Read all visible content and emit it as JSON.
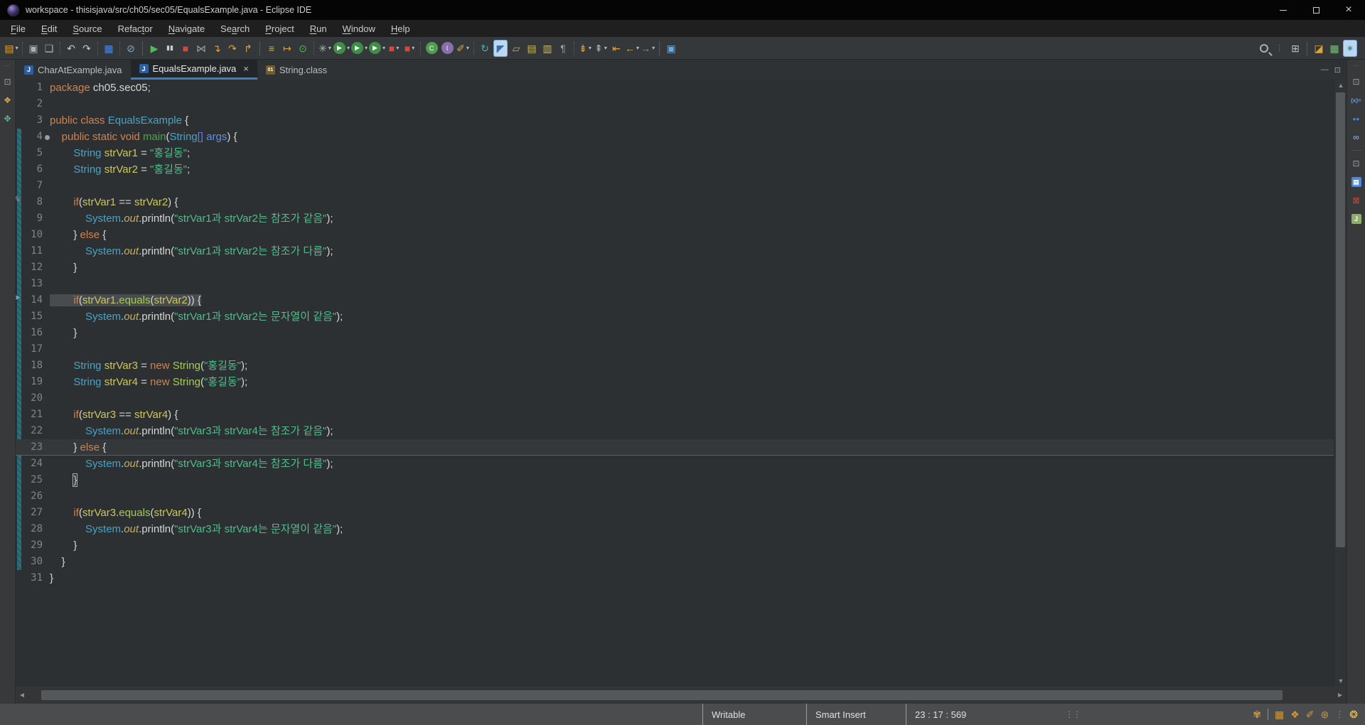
{
  "window": {
    "title": "workspace - thisisjava/src/ch05/sec05/EqualsExample.java - Eclipse IDE",
    "controls": {
      "minimize": "minimize",
      "maximize": "maximize",
      "close": "×"
    }
  },
  "menu": {
    "items": [
      {
        "label": "File",
        "mn": 0
      },
      {
        "label": "Edit",
        "mn": 0
      },
      {
        "label": "Source",
        "mn": 0
      },
      {
        "label": "Refactor",
        "mn": 5
      },
      {
        "label": "Navigate",
        "mn": 0
      },
      {
        "label": "Search",
        "mn": 2
      },
      {
        "label": "Project",
        "mn": 0
      },
      {
        "label": "Run",
        "mn": 0
      },
      {
        "label": "Window",
        "mn": 0
      },
      {
        "label": "Help",
        "mn": 0
      }
    ]
  },
  "toolbar": {
    "items": [
      {
        "n": "new-wizard",
        "g": "▤",
        "c": "#d8a947",
        "dd": true
      },
      {
        "t": "sep"
      },
      {
        "n": "save",
        "g": "▣",
        "c": "#a9afb3"
      },
      {
        "n": "save-all",
        "g": "❏",
        "c": "#a9afb3"
      },
      {
        "t": "sep"
      },
      {
        "n": "undo",
        "g": "↶",
        "c": "#c7cbce"
      },
      {
        "n": "redo",
        "g": "↷",
        "c": "#c7cbce"
      },
      {
        "t": "sep"
      },
      {
        "n": "open-console",
        "g": "▦",
        "c": "#4e86d8"
      },
      {
        "t": "sep"
      },
      {
        "n": "skip-all-breakpoints",
        "g": "⊘",
        "c": "#8fa6c2"
      },
      {
        "t": "bar"
      },
      {
        "n": "resume",
        "g": "▶",
        "c": "#55b85c"
      },
      {
        "n": "pause",
        "g": "▮▮",
        "c": "#c8cdcf"
      },
      {
        "n": "terminate",
        "g": "■",
        "c": "#d8453c"
      },
      {
        "n": "disconnect",
        "g": "⋈",
        "c": "#9a9fa3"
      },
      {
        "n": "step-into",
        "g": "↴",
        "c": "#dca43e"
      },
      {
        "n": "step-over",
        "g": "↷",
        "c": "#dca43e"
      },
      {
        "n": "step-return",
        "g": "↱",
        "c": "#dca43e"
      },
      {
        "t": "bar"
      },
      {
        "n": "use-step-filters",
        "g": "≡",
        "c": "#c0b26a"
      },
      {
        "n": "run-to-line",
        "g": "↦",
        "c": "#dca43e"
      },
      {
        "n": "terminate-all",
        "g": "⊙",
        "c": "#55b85c"
      },
      {
        "t": "sep"
      },
      {
        "n": "new-launch-config",
        "g": "✳",
        "c": "#9fbfa8",
        "dd": true
      },
      {
        "n": "debug",
        "g": "▶",
        "bg": "#3e8f46",
        "dd": true
      },
      {
        "n": "run",
        "g": "▶",
        "bg": "#3e8f46",
        "dd": true
      },
      {
        "n": "coverage",
        "g": "▶",
        "bg": "#3e8f46",
        "dd": true
      },
      {
        "n": "profile",
        "g": "■",
        "c": "#d8453c",
        "dd": true
      },
      {
        "n": "stop",
        "g": "■",
        "c": "#d8453c",
        "dd": true
      },
      {
        "t": "sep"
      },
      {
        "n": "new-java-class",
        "g": "C",
        "bg": "#4e9e4e"
      },
      {
        "n": "new-java-interface",
        "g": "I",
        "bg": "#8a6fae"
      },
      {
        "n": "external-tools",
        "g": "✐",
        "c": "#dca43e",
        "dd": true
      },
      {
        "t": "sep"
      },
      {
        "n": "refresh",
        "g": "↻",
        "c": "#4fb0a5"
      },
      {
        "n": "devstyle",
        "g": "◤",
        "c": "#3a6ea5",
        "act": true
      },
      {
        "n": "open-resource",
        "g": "▱",
        "c": "#c9a14e"
      },
      {
        "n": "show-source",
        "g": "▤",
        "c": "#c9b96a"
      },
      {
        "n": "templates",
        "g": "▥",
        "c": "#c9b96a"
      },
      {
        "n": "show-whitespace",
        "g": "¶",
        "c": "#9aa0a4"
      },
      {
        "t": "sep"
      },
      {
        "n": "next-annotation",
        "g": "⇟",
        "c": "#dca43e",
        "dd": true
      },
      {
        "n": "previous-annotation",
        "g": "⇞",
        "c": "#aeb4b8",
        "dd": true
      },
      {
        "n": "last-edit-location",
        "g": "⇤",
        "c": "#dca43e"
      },
      {
        "n": "back",
        "g": "←",
        "c": "#dca43e",
        "dd": true
      },
      {
        "n": "forward",
        "g": "→",
        "c": "#8a8f93",
        "dd": true
      },
      {
        "t": "bar"
      },
      {
        "n": "pin-editor",
        "g": "▣",
        "c": "#6fa8dc"
      }
    ],
    "right": [
      {
        "n": "search",
        "search": true
      },
      {
        "t": "grip"
      },
      {
        "n": "open-perspective",
        "g": "⊞",
        "c": "#b9bec2"
      },
      {
        "t": "bar"
      },
      {
        "n": "perspective-devstyle",
        "g": "◪",
        "c": "#dca43e"
      },
      {
        "n": "perspective-resource",
        "g": "▦",
        "c": "#7fbf7f"
      },
      {
        "n": "perspective-java",
        "g": "✴",
        "c": "#2e8f8a",
        "act": true
      }
    ]
  },
  "tabs": {
    "items": [
      {
        "label": "CharAtExample.java",
        "icon": "J",
        "icon_bg": "#2e5e9e",
        "active": false
      },
      {
        "label": "EqualsExample.java",
        "icon": "J",
        "icon_bg": "#2e5e9e",
        "active": true,
        "close": "×"
      },
      {
        "label": "String.class",
        "icon": "01",
        "icon_bg": "#6e5f33",
        "active": false
      }
    ],
    "strip_buttons": [
      {
        "n": "minimize-view",
        "g": "—"
      },
      {
        "n": "maximize-view",
        "g": "⊡"
      }
    ]
  },
  "leftbar": {
    "icons": [
      {
        "n": "restore-views",
        "g": "⊡",
        "c": "#9aa0a4"
      },
      {
        "n": "package-explorer",
        "g": "❖",
        "c": "#d8a947"
      },
      {
        "n": "outline",
        "g": "✥",
        "c": "#6faf8f"
      }
    ]
  },
  "rightbar": {
    "icons": [
      {
        "n": "restore-views",
        "g": "⊡",
        "c": "#9aa0a4"
      },
      {
        "n": "variables",
        "g": "(x)=",
        "c": "#6f9fe0",
        "txt": true
      },
      {
        "n": "breakpoints",
        "g": "●●",
        "c": "#4e86d8",
        "txt": true
      },
      {
        "n": "expressions",
        "g": "∞",
        "c": "#9fc0e8"
      },
      {
        "t": "sep"
      },
      {
        "n": "restore-views-2",
        "g": "⊡",
        "c": "#9aa0a4"
      },
      {
        "n": "console",
        "g": "▤",
        "bg": "#4e86d8"
      },
      {
        "n": "problems",
        "g": "⊠",
        "c": "#d8453c"
      },
      {
        "n": "junit",
        "g": "J",
        "bg": "#8fae6b"
      }
    ]
  },
  "editor": {
    "fold_line": 4,
    "diff_start": 4,
    "diff_end": 30,
    "sel_line": 14,
    "cur_line": 23,
    "markers": [
      {
        "line": 8,
        "glyph": "✎",
        "c": "#9aa0a4",
        "name": "edited-marker"
      },
      {
        "line": 14,
        "glyph": "➤",
        "c": "#6faab8",
        "name": "last-edit-marker"
      }
    ],
    "lines": [
      {
        "n": 1,
        "t": [
          [
            "k",
            "package"
          ],
          [
            "p",
            " ch05.sec05;"
          ]
        ]
      },
      {
        "n": 2,
        "t": []
      },
      {
        "n": 3,
        "t": [
          [
            "k",
            "public"
          ],
          [
            "p",
            " "
          ],
          [
            "k",
            "class"
          ],
          [
            "p",
            " "
          ],
          [
            "y",
            "EqualsExample"
          ],
          [
            "p",
            " {"
          ]
        ]
      },
      {
        "n": 4,
        "t": [
          [
            "p",
            "    "
          ],
          [
            "k",
            "public"
          ],
          [
            "p",
            " "
          ],
          [
            "k",
            "static"
          ],
          [
            "p",
            " "
          ],
          [
            "k",
            "void"
          ],
          [
            "p",
            " "
          ],
          [
            "d",
            "main"
          ],
          [
            "p",
            "("
          ],
          [
            "y",
            "String"
          ],
          [
            "b",
            "[]"
          ],
          [
            "p",
            " "
          ],
          [
            "a",
            "args"
          ],
          [
            "p",
            ") {"
          ]
        ]
      },
      {
        "n": 5,
        "t": [
          [
            "p",
            "        "
          ],
          [
            "y",
            "String"
          ],
          [
            "p",
            " "
          ],
          [
            "v",
            "strVar1"
          ],
          [
            "p",
            " = "
          ],
          [
            "s",
            "\"홍길동\""
          ],
          [
            "p",
            ";"
          ]
        ]
      },
      {
        "n": 6,
        "t": [
          [
            "p",
            "        "
          ],
          [
            "y",
            "String"
          ],
          [
            "p",
            " "
          ],
          [
            "v",
            "strVar2"
          ],
          [
            "p",
            " = "
          ],
          [
            "s",
            "\"홍길동\""
          ],
          [
            "p",
            ";"
          ]
        ]
      },
      {
        "n": 7,
        "t": []
      },
      {
        "n": 8,
        "t": [
          [
            "p",
            "        "
          ],
          [
            "k",
            "if"
          ],
          [
            "p",
            "("
          ],
          [
            "v",
            "strVar1"
          ],
          [
            "p",
            " == "
          ],
          [
            "v",
            "strVar2"
          ],
          [
            "p",
            ") {"
          ]
        ]
      },
      {
        "n": 9,
        "t": [
          [
            "p",
            "            "
          ],
          [
            "y",
            "System"
          ],
          [
            "p",
            "."
          ],
          [
            "f",
            "out"
          ],
          [
            "p",
            ".println("
          ],
          [
            "s",
            "\"strVar1과 strVar2는 참조가 같음\""
          ],
          [
            "p",
            ");"
          ]
        ]
      },
      {
        "n": 10,
        "t": [
          [
            "p",
            "        } "
          ],
          [
            "k",
            "else"
          ],
          [
            "p",
            " {"
          ]
        ]
      },
      {
        "n": 11,
        "t": [
          [
            "p",
            "            "
          ],
          [
            "y",
            "System"
          ],
          [
            "p",
            "."
          ],
          [
            "f",
            "out"
          ],
          [
            "p",
            ".println("
          ],
          [
            "s",
            "\"strVar1과 strVar2는 참조가 다름\""
          ],
          [
            "p",
            ");"
          ]
        ]
      },
      {
        "n": 12,
        "t": [
          [
            "p",
            "        }"
          ]
        ]
      },
      {
        "n": 13,
        "t": []
      },
      {
        "n": 14,
        "t": [
          [
            "p",
            "        "
          ],
          [
            "k",
            "if"
          ],
          [
            "p",
            "("
          ],
          [
            "v",
            "strVar1"
          ],
          [
            "p",
            "."
          ],
          [
            "m",
            "equals"
          ],
          [
            "p",
            "("
          ],
          [
            "v",
            "strVar2"
          ],
          [
            "p",
            ")) {"
          ]
        ]
      },
      {
        "n": 15,
        "t": [
          [
            "p",
            "            "
          ],
          [
            "y",
            "System"
          ],
          [
            "p",
            "."
          ],
          [
            "f",
            "out"
          ],
          [
            "p",
            ".println("
          ],
          [
            "s",
            "\"strVar1과 strVar2는 문자열이 같음\""
          ],
          [
            "p",
            ");"
          ]
        ]
      },
      {
        "n": 16,
        "t": [
          [
            "p",
            "        }"
          ]
        ]
      },
      {
        "n": 17,
        "t": []
      },
      {
        "n": 18,
        "t": [
          [
            "p",
            "        "
          ],
          [
            "y",
            "String"
          ],
          [
            "p",
            " "
          ],
          [
            "v",
            "strVar3"
          ],
          [
            "p",
            " = "
          ],
          [
            "k",
            "new"
          ],
          [
            "p",
            " "
          ],
          [
            "m",
            "String"
          ],
          [
            "p",
            "("
          ],
          [
            "s",
            "\"홍길동\""
          ],
          [
            "p",
            ");"
          ]
        ]
      },
      {
        "n": 19,
        "t": [
          [
            "p",
            "        "
          ],
          [
            "y",
            "String"
          ],
          [
            "p",
            " "
          ],
          [
            "v",
            "strVar4"
          ],
          [
            "p",
            " = "
          ],
          [
            "k",
            "new"
          ],
          [
            "p",
            " "
          ],
          [
            "m",
            "String"
          ],
          [
            "p",
            "("
          ],
          [
            "s",
            "\"홍길동\""
          ],
          [
            "p",
            ");"
          ]
        ]
      },
      {
        "n": 20,
        "t": []
      },
      {
        "n": 21,
        "t": [
          [
            "p",
            "        "
          ],
          [
            "k",
            "if"
          ],
          [
            "p",
            "("
          ],
          [
            "v",
            "strVar3"
          ],
          [
            "p",
            " == "
          ],
          [
            "v",
            "strVar4"
          ],
          [
            "p",
            ") {"
          ]
        ]
      },
      {
        "n": 22,
        "t": [
          [
            "p",
            "            "
          ],
          [
            "y",
            "System"
          ],
          [
            "p",
            "."
          ],
          [
            "f",
            "out"
          ],
          [
            "p",
            ".println("
          ],
          [
            "s",
            "\"strVar3과 strVar4는 참조가 같음\""
          ],
          [
            "p",
            ");"
          ]
        ]
      },
      {
        "n": 23,
        "t": [
          [
            "p",
            "        } "
          ],
          [
            "k",
            "else"
          ],
          [
            "p",
            " {"
          ]
        ]
      },
      {
        "n": 24,
        "t": [
          [
            "p",
            "            "
          ],
          [
            "y",
            "System"
          ],
          [
            "p",
            "."
          ],
          [
            "f",
            "out"
          ],
          [
            "p",
            ".println("
          ],
          [
            "s",
            "\"strVar3과 strVar4는 참조가 다름\""
          ],
          [
            "p",
            ");"
          ]
        ]
      },
      {
        "n": 25,
        "t": [
          [
            "p",
            "        "
          ],
          [
            "x",
            "}"
          ]
        ]
      },
      {
        "n": 26,
        "t": []
      },
      {
        "n": 27,
        "t": [
          [
            "p",
            "        "
          ],
          [
            "k",
            "if"
          ],
          [
            "p",
            "("
          ],
          [
            "v",
            "strVar3"
          ],
          [
            "p",
            "."
          ],
          [
            "m",
            "equals"
          ],
          [
            "p",
            "("
          ],
          [
            "v",
            "strVar4"
          ],
          [
            "p",
            ")) {"
          ]
        ]
      },
      {
        "n": 28,
        "t": [
          [
            "p",
            "            "
          ],
          [
            "y",
            "System"
          ],
          [
            "p",
            "."
          ],
          [
            "f",
            "out"
          ],
          [
            "p",
            ".println("
          ],
          [
            "s",
            "\"strVar3과 strVar4는 문자열이 같음\""
          ],
          [
            "p",
            ");"
          ]
        ]
      },
      {
        "n": 29,
        "t": [
          [
            "p",
            "        }"
          ]
        ]
      },
      {
        "n": 30,
        "t": [
          [
            "p",
            "    }"
          ]
        ]
      },
      {
        "n": 31,
        "t": [
          [
            "p",
            "}"
          ]
        ]
      }
    ]
  },
  "scrollbars": {
    "up": "▲",
    "down": "▼",
    "left": "◄",
    "right": "►"
  },
  "status": {
    "writable": "Writable",
    "insert_mode": "Smart Insert",
    "position": "23 : 17 : 569",
    "icons": [
      {
        "n": "hand-icon",
        "g": "✾",
        "c": "#d29a3a"
      },
      {
        "t": "bar"
      },
      {
        "n": "map-icon",
        "g": "▦",
        "c": "#d29a3a"
      },
      {
        "n": "graduation-cap-icon",
        "g": "❖",
        "c": "#d29a3a"
      },
      {
        "n": "magic-wand-icon",
        "g": "✐",
        "c": "#d29a3a"
      },
      {
        "n": "help-wheel-icon",
        "g": "⊛",
        "c": "#d29a3a"
      },
      {
        "t": "grip"
      },
      {
        "n": "lightbulb-icon",
        "g": "❂",
        "c": "#f2c94c"
      }
    ]
  }
}
